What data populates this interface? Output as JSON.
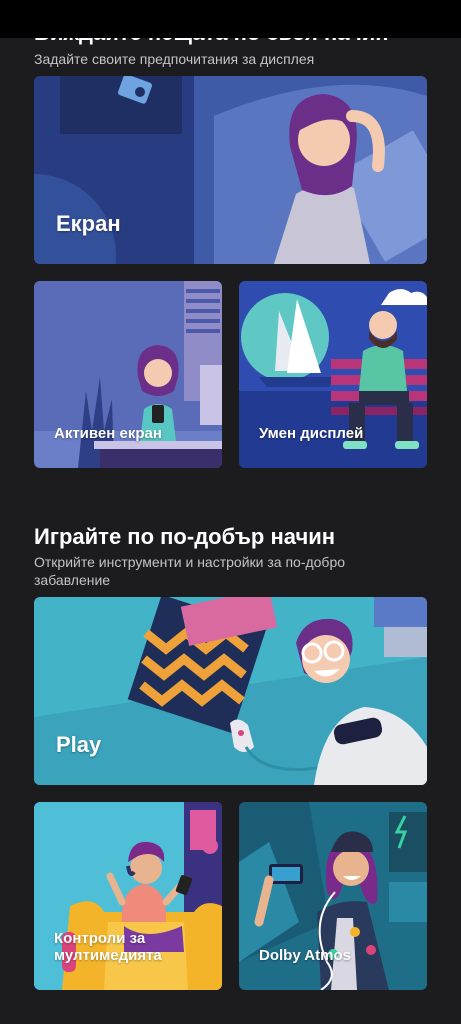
{
  "section1": {
    "title": "Виждайте нещата по своя начин",
    "subtitle": "Задайте своите предпочитания за дисплея"
  },
  "cards1": {
    "display": "Екран",
    "active_display": "Активен екран",
    "smart_display": "Умен дисплей"
  },
  "section2": {
    "title": "Играйте по по-добър начин",
    "subtitle": "Открийте инструменти и настройки за по-добро забавление"
  },
  "cards2": {
    "play": "Play",
    "media_controls": "Контроли за мултимедията",
    "dolby": "Dolby Atmos"
  },
  "colors": {
    "background": "#1c1c1e",
    "status_bar": "#000000",
    "subtitle_text": "#c4c4c8"
  }
}
